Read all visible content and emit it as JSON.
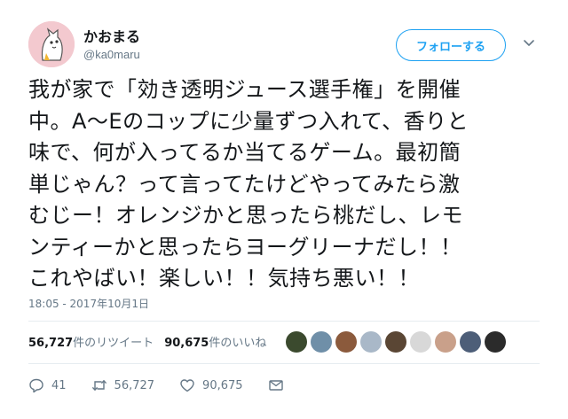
{
  "user": {
    "display_name": "かおまる",
    "handle": "@ka0maru"
  },
  "follow_button_label": "フォローする",
  "tweet": {
    "lines": [
      "我が家で「効き透明ジュース選手権」を開催",
      "中。A〜Eのコップに少量ずつ入れて、香りと",
      "味で、何が入ってるか当てるゲーム。最初簡",
      "単じゃん？って言ってたけどやってみたら激",
      "むじー！オレンジかと思ったら桃だし、レモ",
      "ンティーかと思ったらヨーグリーナだし！！",
      "これやばい！楽しい！！気持ち悪い！！"
    ],
    "timestamp": "18:05 - 2017年10月1日"
  },
  "stats": {
    "retweets_count": "56,727",
    "retweets_label": "件のリツイート",
    "likes_count": "90,675",
    "likes_label": "件のいいね"
  },
  "liker_colors": [
    "#3b4a2e",
    "#6f8fa8",
    "#8b5a3c",
    "#a9b8c8",
    "#5a4634",
    "#d8d8d8",
    "#c9a08a",
    "#4d5e78",
    "#2b2b2b"
  ],
  "actions": {
    "reply_count": "41",
    "retweet_count": "56,727",
    "like_count": "90,675"
  },
  "colors": {
    "accent": "#1da1f2",
    "secondary_text": "#657786",
    "avatar_bg": "#f3c9cf"
  },
  "icons": {
    "caret": "chevron-down-icon",
    "reply": "reply-icon",
    "retweet": "retweet-icon",
    "like": "heart-icon",
    "dm": "envelope-icon"
  }
}
